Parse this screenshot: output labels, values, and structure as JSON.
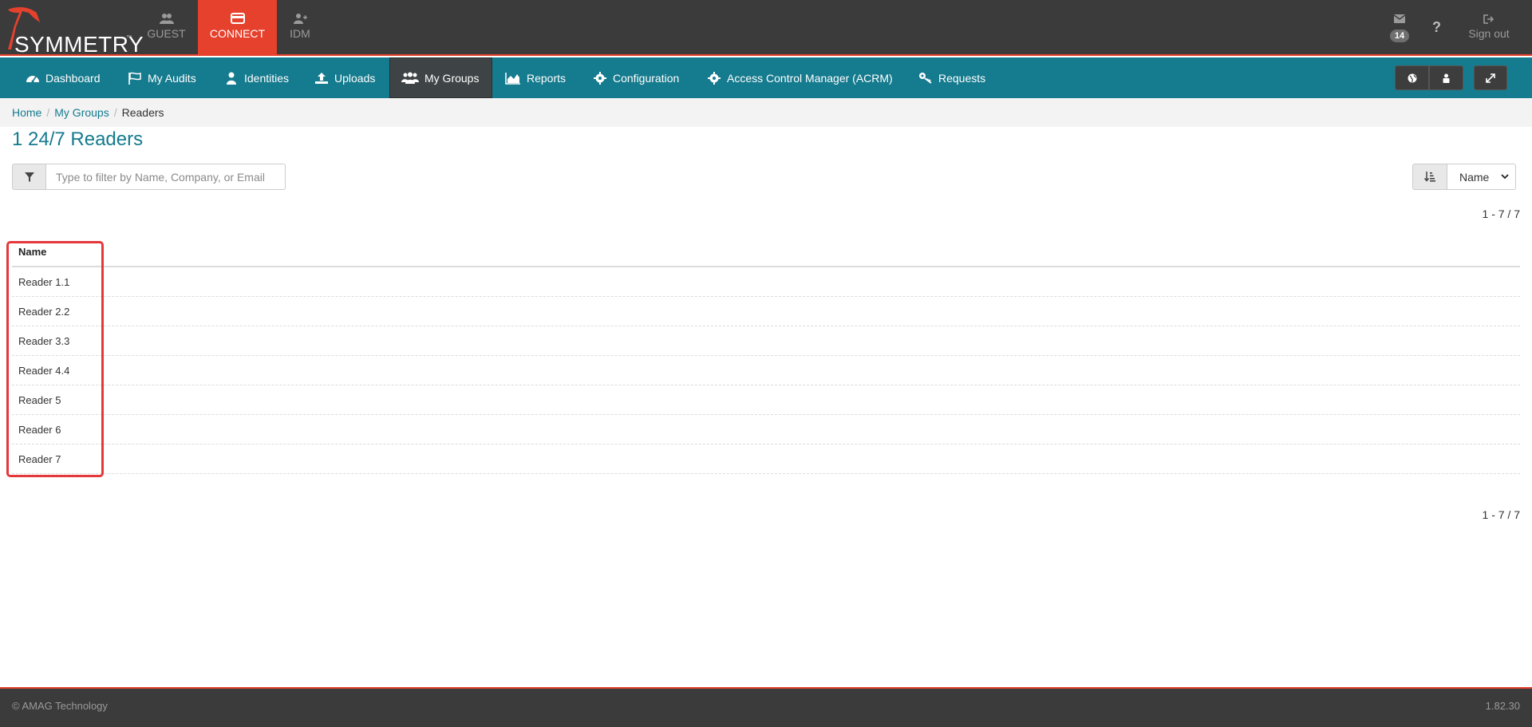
{
  "logo": {
    "text": "SYMMETRY",
    "tm": "™"
  },
  "app_tabs": [
    {
      "label": "GUEST",
      "icon": "users-icon",
      "active": false
    },
    {
      "label": "CONNECT",
      "icon": "card-icon",
      "active": true
    },
    {
      "label": "IDM",
      "icon": "user-plus-icon",
      "active": false
    }
  ],
  "top_right": {
    "mail_count": "14",
    "help": "?",
    "signout_label": "Sign out"
  },
  "nav": {
    "items": [
      {
        "label": "Dashboard",
        "icon": "dashboard-icon"
      },
      {
        "label": "My Audits",
        "icon": "flag-icon"
      },
      {
        "label": "Identities",
        "icon": "user-icon"
      },
      {
        "label": "Uploads",
        "icon": "upload-icon"
      },
      {
        "label": "My Groups",
        "icon": "group-icon",
        "active": true
      },
      {
        "label": "Reports",
        "icon": "area-chart-icon"
      },
      {
        "label": "Configuration",
        "icon": "gear-icon"
      },
      {
        "label": "Access Control Manager (ACRM)",
        "icon": "gear-icon"
      },
      {
        "label": "Requests",
        "icon": "key-icon"
      }
    ]
  },
  "breadcrumb": {
    "home": "Home",
    "my_groups": "My Groups",
    "current": "Readers"
  },
  "page_title": "1 24/7 Readers",
  "filter": {
    "placeholder": "Type to filter by Name, Company, or Email"
  },
  "sort": {
    "selected": "Name"
  },
  "pagination": {
    "top": "1 - 7 / 7",
    "bottom": "1 - 7 / 7"
  },
  "table": {
    "header": "Name",
    "rows": [
      "Reader 1.1",
      "Reader 2.2",
      "Reader 3.3",
      "Reader 4.4",
      "Reader 5",
      "Reader 6",
      "Reader 7"
    ]
  },
  "footer": {
    "copyright": "© AMAG Technology",
    "version": "1.82.30"
  },
  "colors": {
    "nav": "#157b8e",
    "accent": "#e5412d",
    "topbar": "#3b3b3b",
    "highlight": "#e5383b"
  }
}
